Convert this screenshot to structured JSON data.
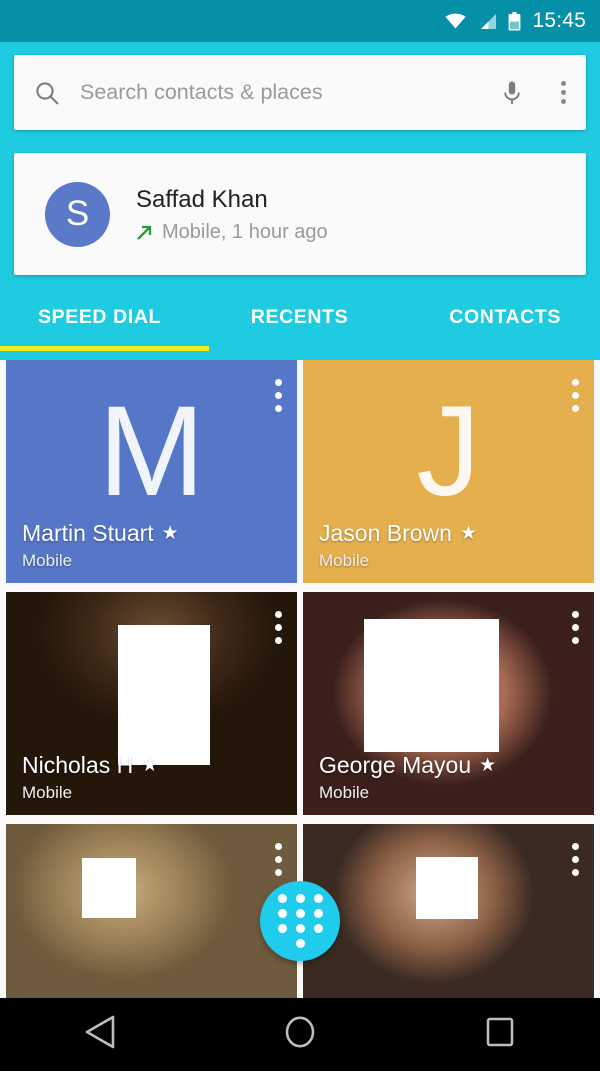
{
  "statusbar": {
    "time": "15:45",
    "icons": [
      "wifi-icon",
      "signal-icon",
      "battery-icon"
    ]
  },
  "search": {
    "placeholder": "Search contacts & places",
    "search_icon": "search-icon",
    "voice_icon": "microphone-icon",
    "overflow_icon": "overflow-menu-icon"
  },
  "recent_call": {
    "avatar_initial": "S",
    "avatar_color": "#5b79c9",
    "name": "Saffad Khan",
    "call_type_icon": "outgoing-call-arrow-icon",
    "call_type_color": "#1f9d3a",
    "details": "Mobile, 1 hour ago"
  },
  "tabs": {
    "items": [
      {
        "label": "SPEED DIAL",
        "selected": true
      },
      {
        "label": "RECENTS",
        "selected": false
      },
      {
        "label": "CONTACTS",
        "selected": false
      }
    ],
    "indicator_color": "#f2ec1b"
  },
  "colors": {
    "status_bar": "#0590a8",
    "header": "#1ecbe1",
    "fab": "#20ccec",
    "tile_blue": "#5677c8",
    "tile_amber": "#e5af4e",
    "nav_bar": "#000000"
  },
  "speed_dial": {
    "tiles": [
      {
        "name": "Martin Stuart",
        "subtitle": "Mobile",
        "star": "★",
        "letter": "M",
        "kind": "letter",
        "bg": "#5677c8",
        "overflow_icon": "overflow-menu-icon"
      },
      {
        "name": "Jason Brown",
        "subtitle": "Mobile",
        "star": "★",
        "letter": "J",
        "kind": "letter",
        "bg": "#e5af4e",
        "overflow_icon": "overflow-menu-icon"
      },
      {
        "name": "Nicholas H",
        "subtitle": "Mobile",
        "star": "★",
        "letter": "",
        "kind": "photo",
        "bg": "",
        "overflow_icon": "overflow-menu-icon"
      },
      {
        "name": "George Mayou",
        "subtitle": "Mobile",
        "star": "★",
        "letter": "",
        "kind": "photo",
        "bg": "",
        "overflow_icon": "overflow-menu-icon"
      },
      {
        "name": "",
        "subtitle": "",
        "star": "",
        "letter": "",
        "kind": "photo",
        "bg": "",
        "overflow_icon": "overflow-menu-icon"
      },
      {
        "name": "",
        "subtitle": "",
        "star": "",
        "letter": "",
        "kind": "photo",
        "bg": "",
        "overflow_icon": "overflow-menu-icon"
      }
    ]
  },
  "fab": {
    "icon": "dialpad-icon",
    "label": ""
  },
  "navbar": {
    "back_icon": "back-triangle-icon",
    "home_icon": "home-circle-icon",
    "recents_icon": "recents-square-icon"
  }
}
